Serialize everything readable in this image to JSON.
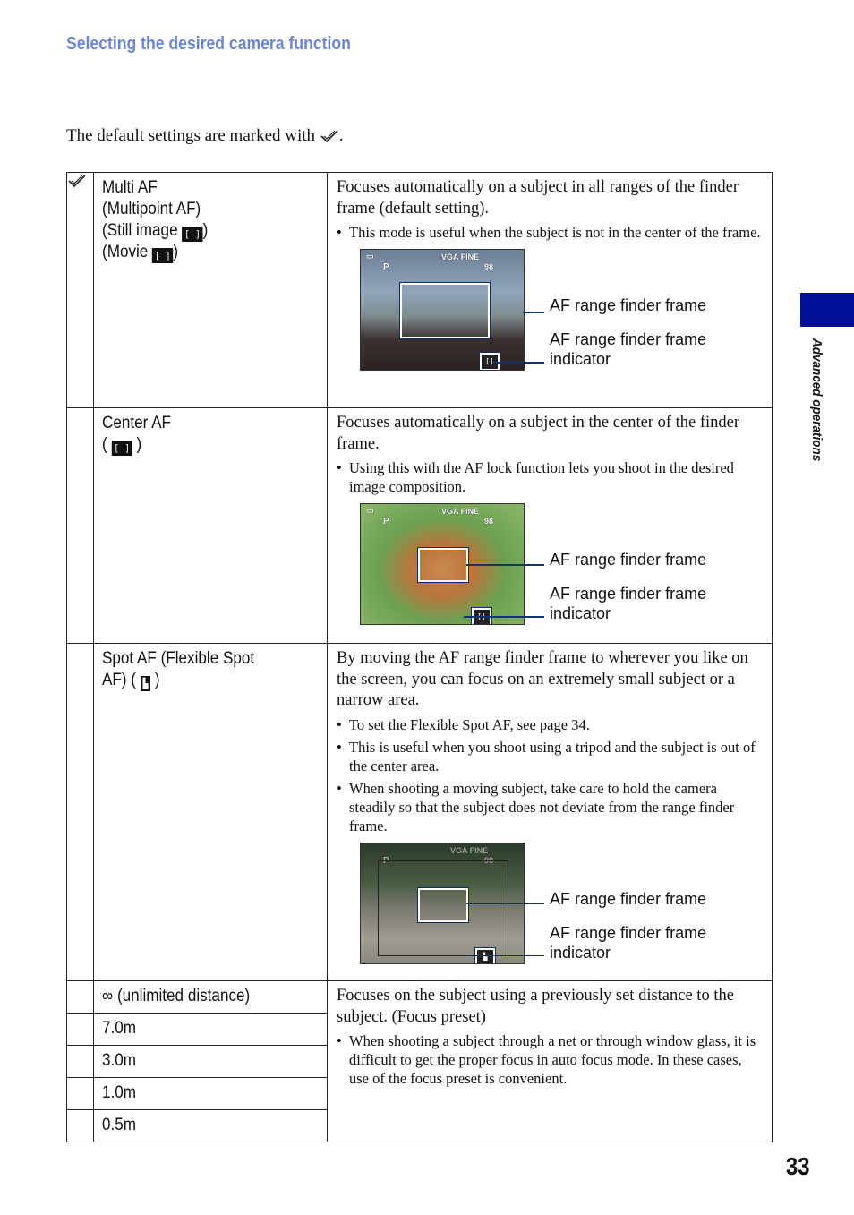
{
  "header": {
    "section_title": "Selecting the desired camera function"
  },
  "intro": {
    "text_before": "The default settings are marked with",
    "text_after": ".",
    "icon": "checkmark-icon"
  },
  "side_tab": {
    "label": "Advanced operations",
    "color": "#000f96"
  },
  "page_number": "33",
  "rows": [
    {
      "default": true,
      "name_lines": [
        "Multi AF",
        "(Multipoint AF)",
        "(Still image",
        "(Movie"
      ],
      "still_icon": "[ ]",
      "movie_icon": "[  ]",
      "description": "Focuses automatically on a subject in all ranges of the finder frame (default setting).",
      "bullets": [
        "This mode is useful when the subject is not in the center of the frame."
      ],
      "figure": {
        "osd_top": "VGA FINE",
        "osd_mode": "P",
        "osd_count": "98",
        "callouts": [
          "AF range finder frame",
          "AF range finder frame indicator"
        ]
      }
    },
    {
      "default": false,
      "name_lines": [
        "Center AF",
        "("
      ],
      "icon": "[ ]",
      "description": "Focuses automatically on a subject in the center of the finder frame.",
      "bullets": [
        "Using this with the AF lock function lets you shoot in the desired image composition."
      ],
      "figure": {
        "osd_top": "VGA FINE",
        "osd_mode": "P",
        "osd_count": "98",
        "callouts": [
          "AF range finder frame",
          "AF range finder frame indicator"
        ]
      }
    },
    {
      "default": false,
      "name_lines": [
        "Spot AF (Flexible Spot",
        "AF) ("
      ],
      "icon": "spot",
      "description": "By moving the AF range finder frame to wherever you like on the screen, you can focus on an extremely small subject or a narrow area.",
      "bullets": [
        "To set the Flexible Spot AF, see page 34.",
        "This is useful when you shoot using a tripod and the subject is out of the center area.",
        "When shooting a moving subject, take care to hold the camera steadily so that the subject does not deviate from the range finder frame."
      ],
      "figure": {
        "osd_top": "VGA FINE",
        "osd_mode": "P",
        "osd_count": "98",
        "callouts": [
          "AF range finder frame",
          "AF range finder frame indicator"
        ]
      }
    }
  ],
  "focus_preset": {
    "options": [
      "∞ (unlimited distance)",
      "7.0m",
      "3.0m",
      "1.0m",
      "0.5m"
    ],
    "description": "Focuses on the subject using a previously set distance to the subject. (Focus preset)",
    "bullets": [
      "When shooting a subject through a net or through window glass, it is difficult to get the proper focus in auto focus mode. In these cases, use of the focus preset is convenient."
    ]
  }
}
